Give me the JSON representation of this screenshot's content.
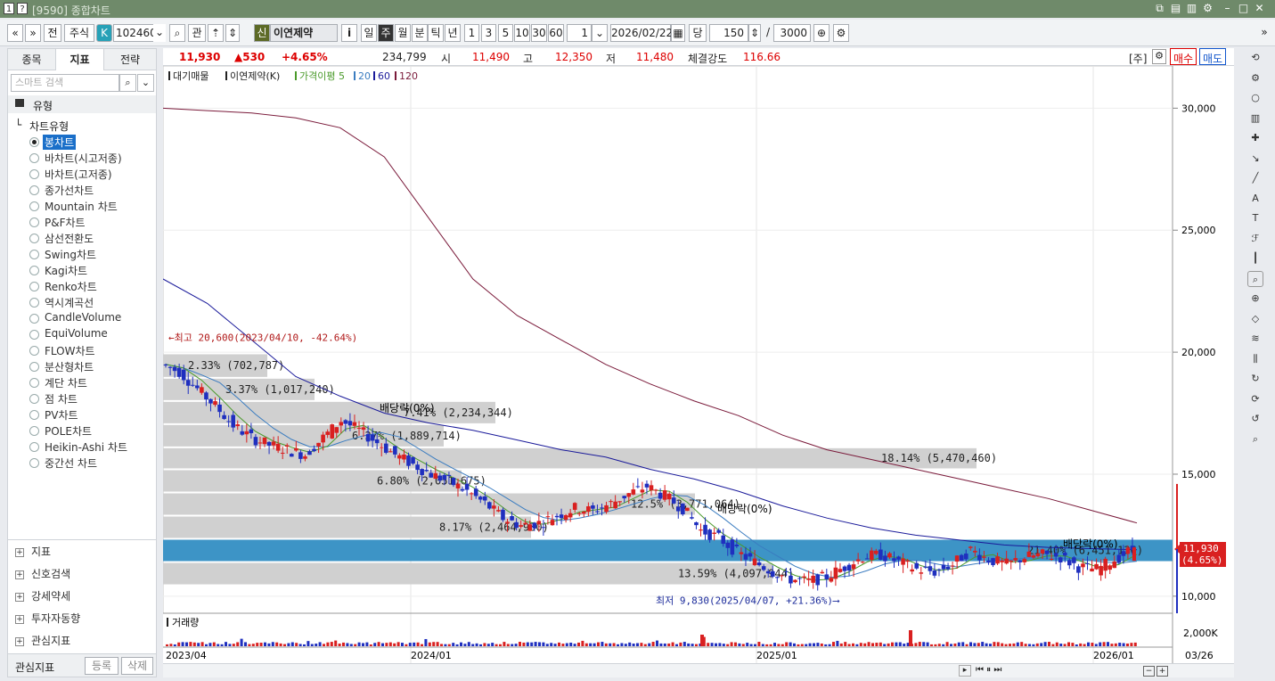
{
  "window": {
    "title": "[9590] 종합차트"
  },
  "toolbar": {
    "stock_code": "102460",
    "stock_name": "이연제약",
    "sin_label": "신",
    "market_label": "주식",
    "k_label": "K",
    "gwan_label": "관",
    "jeon_label": "전",
    "dang_label": "당",
    "periods": [
      "일",
      "주",
      "월",
      "분",
      "틱",
      "년"
    ],
    "selected_period": "주",
    "intervals": [
      "1",
      "3",
      "5",
      "10",
      "30",
      "60"
    ],
    "interval_value": "1",
    "date": "2026/02/22",
    "count": "150",
    "total": "3000",
    "info_label": "i"
  },
  "left_panel": {
    "tabs": [
      "종목",
      "지표",
      "전략"
    ],
    "active_tab": "지표",
    "search_placeholder": "스마트 검색",
    "category": "유형",
    "subcategory": "차트유형",
    "chart_types": [
      "봉차트",
      "바차트(시고저종)",
      "바차트(고저종)",
      "종가선차트",
      "Mountain 차트",
      "P&F차트",
      "삼선전환도",
      "Swing차트",
      "Kagi차트",
      "Renko차트",
      "역시계곡선",
      "CandleVolume",
      "EquiVolume",
      "FLOW차트",
      "분산형차트",
      "계단 차트",
      "점 차트",
      "PV차트",
      "POLE차트",
      "Heikin-Ashi 차트",
      "중간선 차트"
    ],
    "selected_chart_type": "봉차트",
    "groups": [
      "지표",
      "신호검색",
      "강세약세",
      "투자자동향",
      "관심지표"
    ],
    "footer": {
      "label": "관심지표",
      "btn_register": "등록",
      "btn_delete": "삭제"
    }
  },
  "infobar": {
    "price": "11,930",
    "change": "▲530",
    "change_pct": "+4.65%",
    "volume": "234,799",
    "open_label": "시",
    "open": "11,490",
    "high_label": "고",
    "high": "12,350",
    "low_label": "저",
    "low": "11,480",
    "strength_label": "체결강도",
    "strength": "116.66",
    "unit_label": "[주]",
    "buy_label": "매수",
    "sell_label": "매도"
  },
  "chart_data": {
    "type": "candlestick",
    "legend": [
      "대기매물",
      "이연제약(K)",
      "가격이평 5",
      "20",
      "60",
      "120"
    ],
    "legend_colors": [
      "#222",
      "#222",
      "#4a9a2a",
      "#3a7cc0",
      "#1a1a9a",
      "#7a1a3a"
    ],
    "y_ticks": [
      10000,
      15000,
      20000,
      25000,
      30000
    ],
    "y_tick_labels": [
      "10,000",
      "15,000",
      "20,000",
      "25,000",
      "30,000"
    ],
    "ylim": [
      9300,
      31000
    ],
    "x_labels": [
      "2023/04",
      "2024/01",
      "2025/01",
      "2026/01"
    ],
    "x_end_label": "03/26",
    "volume_label": "거래량",
    "volume_tick": "2,000K",
    "last_price_label": "11,930",
    "last_pct_label": "(4.65%)",
    "max_annotation": "←최고 20,600(2023/04/10, -42.64%)",
    "min_annotation": "최저 9,830(2025/04/07, +21.36%)⟶",
    "dividend_labels": [
      "배당락(0%)",
      "배당락(0%)",
      "배당락(0%)"
    ],
    "supply_zones": [
      {
        "low": 18950,
        "high": 19950,
        "label": "2.33% (702,787)"
      },
      {
        "low": 18000,
        "high": 18950,
        "label": "3.37% (1,017,240)"
      },
      {
        "low": 17050,
        "high": 18000,
        "label": "7.41% (2,234,344)"
      },
      {
        "low": 16100,
        "high": 17050,
        "label": "6.27% (1,889,714)"
      },
      {
        "low": 15200,
        "high": 16100,
        "label": "18.14% (5,470,460)"
      },
      {
        "low": 14250,
        "high": 15200,
        "label": "6.80% (2,051,675)"
      },
      {
        "low": 13300,
        "high": 14250,
        "label": "12.5% (3,771,064)"
      },
      {
        "low": 12350,
        "high": 13300,
        "label": "8.17% (2,464,930)"
      },
      {
        "low": 11400,
        "high": 12350,
        "label": "21.40% (6,451,136)",
        "highlight": true
      },
      {
        "low": 10450,
        "high": 11400,
        "label": "13.59% (4,097,944)"
      }
    ],
    "ma_120": [
      30000,
      29900,
      29800,
      29600,
      29200,
      28000,
      25500,
      23000,
      21500,
      20500,
      19500,
      18700,
      18000,
      17400,
      16600,
      16000,
      15600,
      15200,
      14800,
      14400,
      14000,
      13500,
      13000
    ],
    "ma_60": [
      23000,
      22000,
      20500,
      19000,
      18200,
      17500,
      17100,
      16800,
      16400,
      16000,
      15700,
      15200,
      14800,
      14300,
      13700,
      13200,
      12800,
      12500,
      12300,
      12100,
      12000,
      11950,
      11900
    ],
    "price_path": [
      19500,
      19200,
      18500,
      17800,
      17000,
      16500,
      16200,
      16000,
      15800,
      16500,
      17200,
      16800,
      16300,
      15800,
      15400,
      15000,
      14700,
      14300,
      13800,
      13200,
      12900,
      13000,
      13300,
      13600,
      13500,
      13800,
      14200,
      14500,
      14100,
      13600,
      12700,
      12400,
      11800,
      11400,
      11000,
      10700,
      10600,
      10800,
      11200,
      11600,
      11700,
      11400,
      11100,
      11000,
      11300,
      11900,
      11500,
      11300,
      11600,
      11700,
      11600,
      11200,
      11100,
      11500,
      11930
    ]
  },
  "right_tools": [
    "cursor-icon",
    "gear-icon",
    "circle-icon",
    "candle-icon",
    "crosshair-icon",
    "trendline-icon",
    "line-icon",
    "auto-icon",
    "text-icon",
    "fib-icon",
    "bar-icon",
    "zoom-icon",
    "magnify-icon",
    "pattern-icon",
    "wave-icon",
    "grid-icon",
    "cycle-icon",
    "rotate-icon",
    "refresh-icon",
    "search-icon"
  ]
}
